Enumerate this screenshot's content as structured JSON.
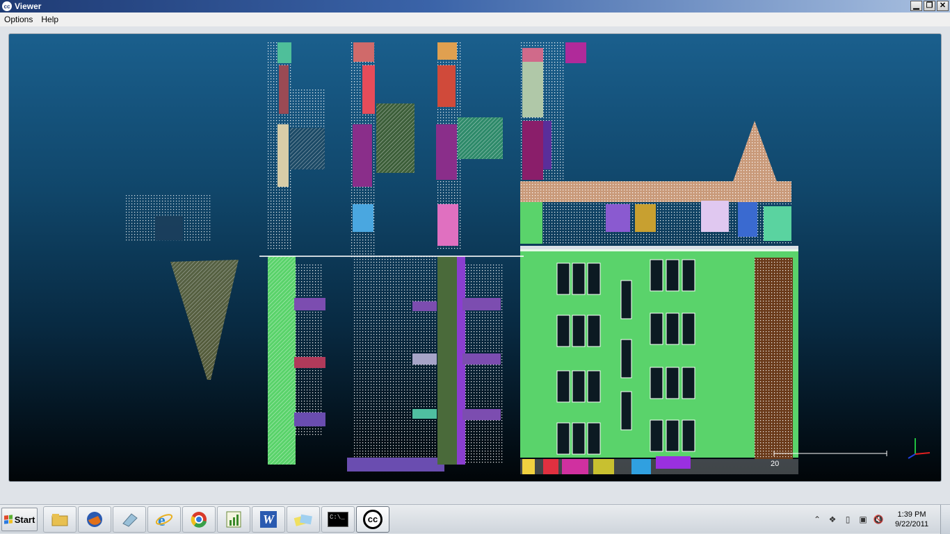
{
  "window": {
    "title": "Viewer",
    "icon_text": "cc",
    "controls": {
      "minimize": "▁",
      "restore": "❐",
      "close": "✕"
    }
  },
  "menu": [
    {
      "label": "Options"
    },
    {
      "label": "Help"
    }
  ],
  "viewport": {
    "content": "colored point-cloud building facade",
    "scale_label": "20",
    "axis_trihedron": "xyz-axes-icon",
    "colors": {
      "sky_top": "#1a5f8d",
      "sky_bottom": "#010508",
      "facade_green": "#5ad36b",
      "points_white": "#ffffff"
    }
  },
  "taskbar": {
    "start_label": "Start",
    "pinned": [
      {
        "name": "explorer-icon"
      },
      {
        "name": "firefox-icon"
      },
      {
        "name": "eraser-app-icon"
      },
      {
        "name": "internet-explorer-icon"
      },
      {
        "name": "chrome-icon"
      },
      {
        "name": "chart-app-icon"
      },
      {
        "name": "word-icon",
        "text": "W"
      },
      {
        "name": "folders-icon"
      },
      {
        "name": "command-prompt-icon",
        "text": "C:\\_"
      },
      {
        "name": "cloudcompare-icon",
        "text": "cc"
      }
    ],
    "clock": {
      "time": "1:39 PM",
      "date": "9/22/2011"
    }
  }
}
